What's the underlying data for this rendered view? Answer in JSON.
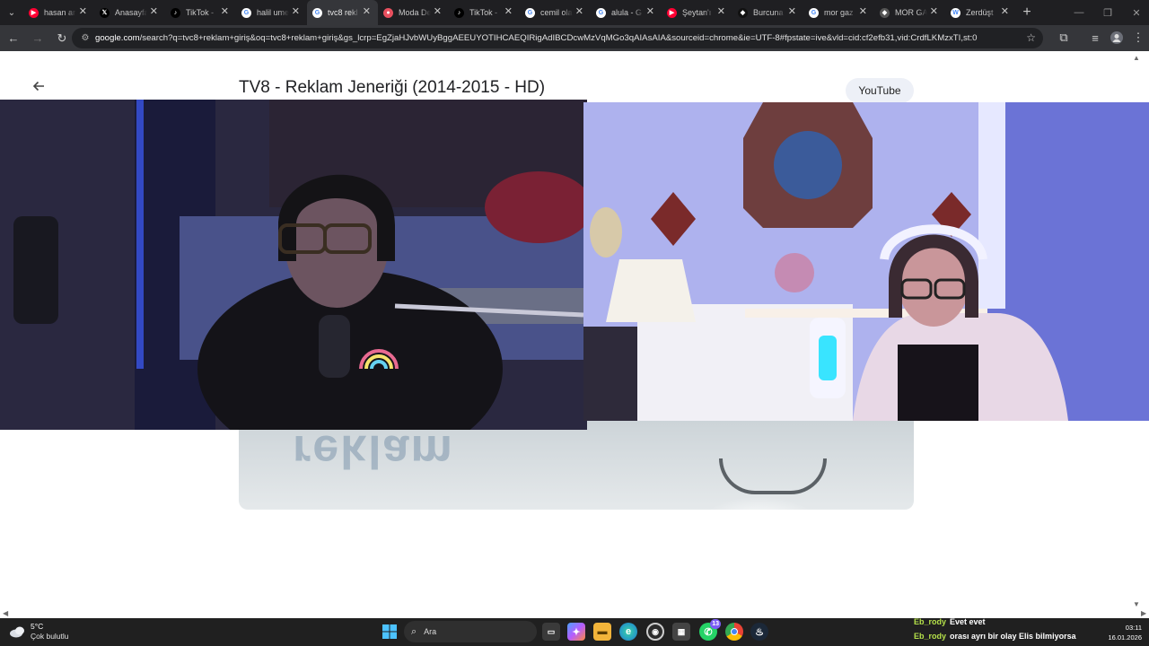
{
  "browser": {
    "tabs": [
      {
        "title": "hasan arı",
        "icon": "youtube-icon",
        "color": "#ff0033",
        "glyph": "▶",
        "active": false
      },
      {
        "title": "Anasayfa",
        "icon": "x-icon",
        "color": "#000000",
        "glyph": "𝕏",
        "active": false
      },
      {
        "title": "TikTok -",
        "icon": "tiktok-icon",
        "color": "#000000",
        "glyph": "♪",
        "active": false
      },
      {
        "title": "halil ume",
        "icon": "google-icon",
        "color": "#ffffff",
        "glyph": "G",
        "active": false
      },
      {
        "title": "tvc8 rekl",
        "icon": "google-icon",
        "color": "#ffffff",
        "glyph": "G",
        "active": true
      },
      {
        "title": "Moda De",
        "icon": "pinterest-icon",
        "color": "#e9505f",
        "glyph": "●",
        "active": false
      },
      {
        "title": "TikTok -",
        "icon": "tiktok-icon",
        "color": "#000000",
        "glyph": "♪",
        "active": false
      },
      {
        "title": "cemil ola",
        "icon": "google-icon",
        "color": "#ffffff",
        "glyph": "G",
        "active": false
      },
      {
        "title": "alula - G",
        "icon": "google-icon",
        "color": "#ffffff",
        "glyph": "G",
        "active": false
      },
      {
        "title": "Şeytan'ı",
        "icon": "youtube-icon",
        "color": "#ff0033",
        "glyph": "▶",
        "active": false
      },
      {
        "title": "Burcuna",
        "icon": "site-icon",
        "color": "#111111",
        "glyph": "◆",
        "active": false
      },
      {
        "title": "mor gaz",
        "icon": "google-icon",
        "color": "#ffffff",
        "glyph": "G",
        "active": false
      },
      {
        "title": "MOR GA",
        "icon": "site-icon",
        "color": "#555555",
        "glyph": "◆",
        "active": false
      },
      {
        "title": "Zerdüşt",
        "icon": "wikipedia-icon",
        "color": "#ffffff",
        "glyph": "W",
        "active": false
      }
    ],
    "url_host": "google.com",
    "url_rest": "/search?q=tvc8+reklam+giriş&oq=tvc8+reklam+giriş&gs_lcrp=EgZjaHJvbWUyBggAEEUYOTIHCAEQIRigAdIBCDcwMzVqMGo3qAIAsAIA&sourceid=chrome&ie=UTF-8#fpstate=ive&vld=cid:cf2efb31,vid:CrdfLKMzxTI,st:0"
  },
  "page": {
    "video_title": "TV8 - Reklam Jeneriği (2014-2015 - HD)",
    "source_label": "YouTube",
    "stage_text": "reklam"
  },
  "taskbar": {
    "weather_temp": "5°C",
    "weather_condition": "Çok bulutlu",
    "search_placeholder": "Ara",
    "whatsapp_badge": "13",
    "chat": [
      {
        "user": "Eb_rody",
        "message": "Evet evet"
      },
      {
        "user": "Eb_rody",
        "message": "orası ayrı bir olay Elis bilmiyorsa"
      }
    ],
    "time": "03:11",
    "date": "16.01.2026"
  }
}
